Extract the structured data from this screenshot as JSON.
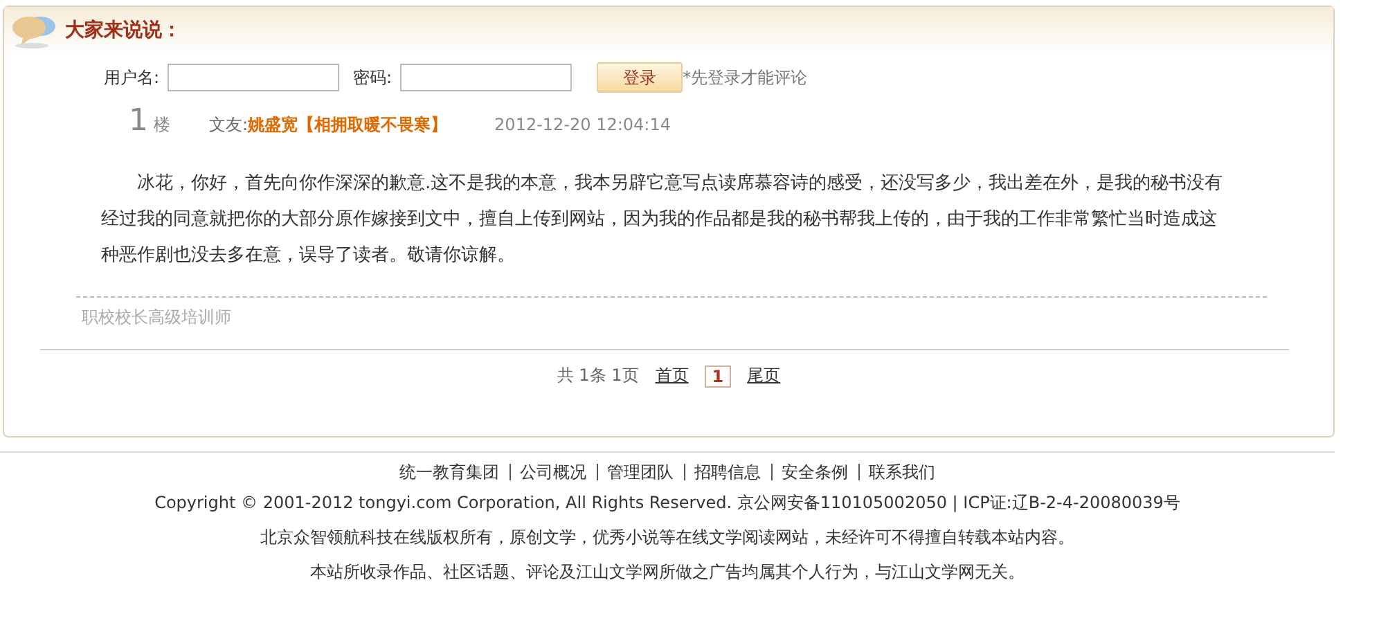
{
  "panel": {
    "title": "大家来说说："
  },
  "login": {
    "username_label": "用户名:",
    "password_label": "密码:",
    "button": "登录",
    "note": "*先登录才能评论"
  },
  "comments": [
    {
      "floor": "1",
      "floor_unit": "楼",
      "author_label": "文友:",
      "author": "姚盛宽【相拥取暖不畏寒】",
      "time": "2012-12-20 12:04:14",
      "body": "冰花，你好，首先向你作深深的歉意.这不是我的本意，我本另辟它意写点读席慕容诗的感受，还没写多少，我出差在外，是我的秘书没有经过我的同意就把你的大部分原作嫁接到文中，擅自上传到网站，因为我的作品都是我的秘书帮我上传的，由于我的工作非常繁忙当时造成这种恶作剧也没去多在意，误导了读者。敬请你谅解。",
      "signature": "职校校长高级培训师"
    }
  ],
  "pagination": {
    "summary": "共 1条 1页",
    "first": "首页",
    "pages": [
      {
        "label": "1",
        "selected": true
      }
    ],
    "last": "尾页"
  },
  "footer": {
    "links": [
      "统一教育集团",
      "公司概况",
      "管理团队",
      "招聘信息",
      "安全条例",
      "联系我们"
    ],
    "lines": [
      "Copyright © 2001-2012 tongyi.com Corporation, All Rights Reserved. 京公网安备110105002050 | ICP证:辽B-2-4-20080039号",
      "北京众智领航科技在线版权所有，原创文学，优秀小说等在线文学阅读网站，未经许可不得擅自转载本站内容。",
      "本站所收录作品、社区话题、评论及江山文学网所做之广告均属其个人行为，与江山文学网无关。"
    ]
  }
}
